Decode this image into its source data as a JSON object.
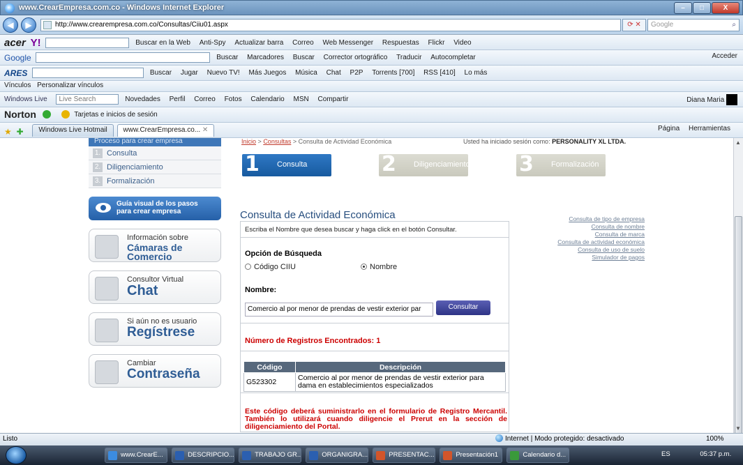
{
  "window": {
    "title": "www.CrearEmpresa.com.co - Windows Internet Explorer",
    "buttons": {
      "minimize": "–",
      "maximize": "□",
      "close": "X"
    }
  },
  "address": {
    "url": "http://www.crearempresa.com.co/Consultas/Ciiu01.aspx",
    "search_placeholder": "Google"
  },
  "toolbars": {
    "acer": {
      "brand": "acer",
      "yahoo": "Y!",
      "items": [
        "Buscar en la Web",
        "Anti-Spy",
        "Actualizar barra",
        "Correo",
        "Web Messenger",
        "Respuestas",
        "Flickr",
        "Video"
      ]
    },
    "google": {
      "brand": "Google",
      "items": [
        "Buscar",
        "Marcadores",
        "Buscar",
        "Corrector ortográfico",
        "Traducir",
        "Autocompletar"
      ],
      "right": "Acceder"
    },
    "ares": {
      "brand": "ARES",
      "items": [
        "Buscar",
        "Jugar",
        "Nuevo TV!",
        "Más Juegos",
        "Música",
        "Chat",
        "P2P",
        "Torrents [700]",
        "RSS [410]",
        "Lo más"
      ]
    },
    "vinculos": {
      "label": "Vínculos",
      "item": "Personalizar vínculos"
    },
    "live": {
      "brand": "Windows Live",
      "search_placeholder": "Live Search",
      "items": [
        "Novedades",
        "Perfil",
        "Correo",
        "Fotos",
        "Calendario",
        "MSN",
        "Compartir"
      ],
      "user": "Diana Maria"
    },
    "norton": {
      "brand": "Norton",
      "item": "Tarjetas e inicios de sesión"
    },
    "tabs": {
      "items": [
        "Windows Live Hotmail",
        "www.CrearEmpresa.co..."
      ],
      "right": [
        "Página",
        "Herramientas"
      ]
    }
  },
  "sidebar": {
    "heading": "Proceso para crear empresa",
    "steps": [
      {
        "num": "1.",
        "label": "Consulta"
      },
      {
        "num": "2.",
        "label": "Diligenciamiento"
      },
      {
        "num": "3.",
        "label": "Formalización"
      }
    ],
    "guia": {
      "line1": "Guía visual de los pasos",
      "line2": "para crear empresa"
    },
    "boxes": [
      {
        "small": "Información sobre",
        "big": "Cámaras de Comercio"
      },
      {
        "small": "Consultor Virtual",
        "big": "Chat"
      },
      {
        "small": "Si aún no es usuario",
        "big": "Regístrese"
      },
      {
        "small": "Cambiar",
        "big": "Contraseña"
      }
    ]
  },
  "breadcrumb": {
    "home": "Inicio",
    "sep": ">",
    "consultas": "Consultas",
    "current": "Consulta de Actividad Económica"
  },
  "session": {
    "label": "Usted ha iniciado sesión como:",
    "user": "PERSONALITY XL LTDA."
  },
  "steps": [
    {
      "num": "1",
      "label": "Consulta"
    },
    {
      "num": "2",
      "label": "Diligenciamiento"
    },
    {
      "num": "3",
      "label": "Formalización"
    }
  ],
  "main": {
    "title": "Consulta de Actividad Económica",
    "instructions": "Escriba el Nombre que desea buscar y haga click en el botón Consultar.",
    "option_title": "Opción de Búsqueda",
    "radio_ciiu": "Código CIIU",
    "radio_nombre": "Nombre",
    "nombre_label": "Nombre:",
    "nombre_value": "Comercio al por menor de prendas de vestir exterior par",
    "consultar": "Consultar",
    "registros": "Número de Registros Encontrados: 1",
    "table": {
      "headers": [
        "Código",
        "Descripción"
      ],
      "rows": [
        {
          "codigo": "G523302",
          "descripcion": "Comercio al por menor de prendas de vestir exterior para dama en establecimientos especializados"
        }
      ]
    },
    "note": "Este código deberá suministrarlo en el formulario de Registro Mercantil. También lo utilizará cuando diligencie el Prerut en la sección de diligenciamiento del Portal."
  },
  "right_links": [
    "Consulta de tipo de empresa",
    "Consulta de nombre",
    "Consulta de marca",
    "Consulta de actividad económica",
    "Consulta de uso de suelo",
    "Simulador de pagos"
  ],
  "status": {
    "left": "Listo",
    "zone": "Internet | Modo protegido: desactivado",
    "zoom": "100%"
  },
  "taskbar": {
    "tasks": [
      "www.CrearE...",
      "DESCRIPCIO...",
      "TRABAJO GR...",
      "ORGANIGRA...",
      "PRESENTAC...",
      "Presentación1",
      "Calendario d..."
    ],
    "lang": "ES",
    "time": "05:37 p.m."
  },
  "colors": {
    "accent": "#2f78c4",
    "error_red": "#cc0000",
    "table_header": "#57687c",
    "sidebar_link": "#3b5f8a"
  }
}
